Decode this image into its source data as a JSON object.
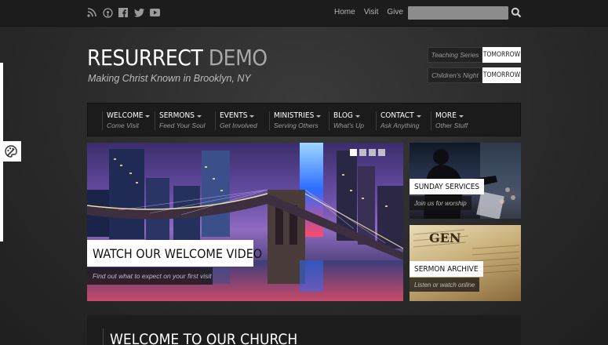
{
  "topbar": {
    "social_icons": [
      "rss-icon",
      "podcast-icon",
      "facebook-icon",
      "twitter-icon",
      "youtube-icon"
    ],
    "links": [
      "Home",
      "Visit",
      "Give"
    ],
    "search_placeholder": "",
    "search_icon": "search-icon"
  },
  "header": {
    "logo_main": "RESURRECT",
    "logo_accent": "DEMO",
    "tagline": "Making Christ Known in Brooklyn, NY",
    "highlights": [
      {
        "label": "Teaching Series",
        "value": "TOMORROW"
      },
      {
        "label": "Children's Night",
        "value": "TOMORROW"
      }
    ]
  },
  "nav": {
    "items": [
      {
        "title": "WELCOME",
        "subtitle": "Come Visit"
      },
      {
        "title": "SERMONS",
        "subtitle": "Feed Your Soul"
      },
      {
        "title": "EVENTS",
        "subtitle": "Get Involved"
      },
      {
        "title": "MINISTRIES",
        "subtitle": "Serving Others"
      },
      {
        "title": "BLOG",
        "subtitle": "What's Up"
      },
      {
        "title": "CONTACT",
        "subtitle": "Ask Anything"
      },
      {
        "title": "MORE",
        "subtitle": "Other Stuff"
      }
    ]
  },
  "slider": {
    "title": "WATCH OUR WELCOME VIDEO",
    "subtitle": "Find out what to expect on your first visit",
    "slide_count": 4,
    "active_slide": 1
  },
  "boxes": [
    {
      "title": "SUNDAY SERVICES",
      "subtitle": "Join us for worship"
    },
    {
      "title": "SERMON ARCHIVE",
      "subtitle": "Listen or watch online"
    }
  ],
  "book_text": "GEN",
  "content": {
    "heading": "WELCOME TO OUR CHURCH"
  },
  "colors": {
    "background": "#2b2b2b",
    "topbar": "#1c1c1c",
    "nav": "#1b1b1b",
    "accent_light": "#ffffff"
  }
}
